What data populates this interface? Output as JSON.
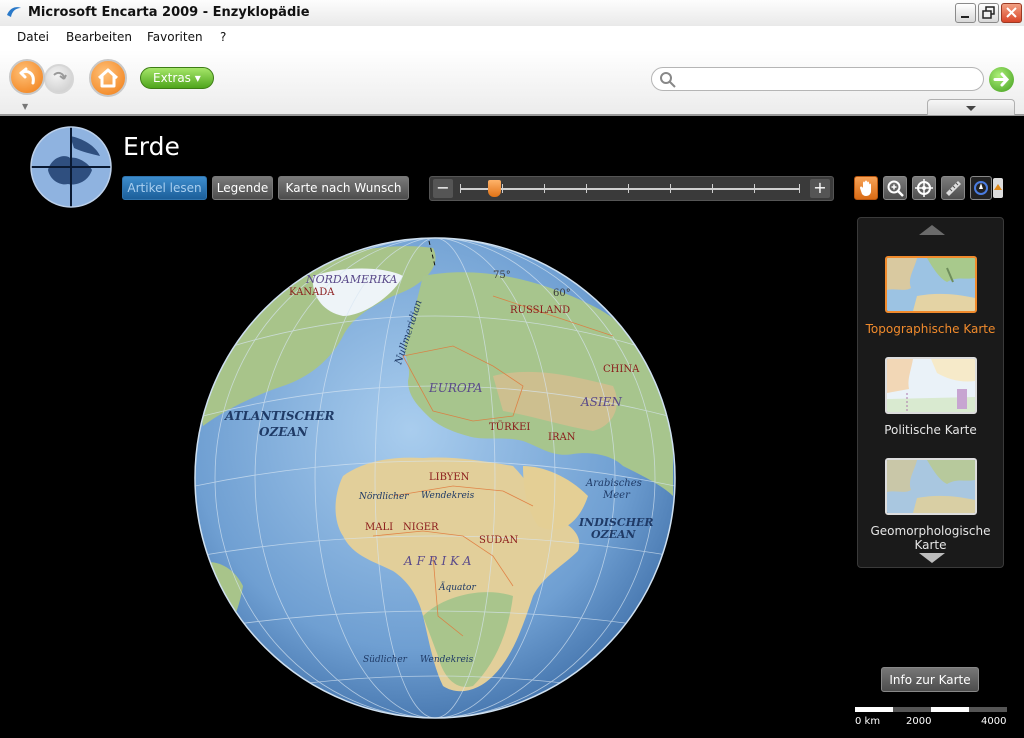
{
  "window": {
    "title": "Microsoft Encarta 2009 - Enzyklopädie"
  },
  "menu": {
    "items": [
      "Datei",
      "Bearbeiten",
      "Favoriten",
      "?"
    ]
  },
  "toolbar": {
    "extras_label": "Extras ▾",
    "search_placeholder": ""
  },
  "page": {
    "title": "Erde"
  },
  "buttons": {
    "article": "Artikel lesen",
    "legend": "Legende",
    "custom_map": "Karte nach Wunsch",
    "info": "Info zur Karte"
  },
  "zoom": {
    "minus": "−",
    "plus": "+",
    "level_fraction": 0.1
  },
  "map_types": [
    {
      "label": "Topographische Karte",
      "selected": true
    },
    {
      "label": "Politische Karte",
      "selected": false
    },
    {
      "label": "Geomorphologische Karte",
      "selected": false
    }
  ],
  "scale": {
    "labels": [
      "0 km",
      "2000",
      "4000"
    ]
  },
  "map_labels": {
    "nordamerika": "NORDAMERIKA",
    "kanada": "KANADA",
    "russland": "RUSSLAND",
    "europa": "EUROPA",
    "china": "CHINA",
    "asien": "ASIEN",
    "atlantik1": "ATLANTISCHER",
    "atlantik2": "OZEAN",
    "tuerkei": "TÜRKEI",
    "iran": "IRAN",
    "libyen": "LIBYEN",
    "noerdlicher": "Nördlicher",
    "wendekreis_n": "Wendekreis",
    "arabisches": "Arabisches",
    "meer": "Meer",
    "mali": "MALI",
    "niger": "NIGER",
    "sudan": "SUDAN",
    "indischer": "INDISCHER",
    "ozean": "OZEAN",
    "afrika": "A F R I K A",
    "aequator": "Äquator",
    "suedlicher": "Südlicher",
    "wendekreis_s": "Wendekreis",
    "nullmeridian": "Nullmeridian",
    "lat75": "75°",
    "lat60": "60°"
  },
  "icons": {
    "app": "encarta-icon",
    "back": "back-arrow-icon",
    "forward": "forward-arrow-icon",
    "home": "home-icon",
    "search": "search-icon",
    "go": "go-arrow-icon",
    "hand": "hand-icon",
    "zoom": "magnifier-icon",
    "locate": "crosshair-icon",
    "measure": "ruler-icon",
    "compass": "compass-icon"
  },
  "colors": {
    "accent": "#f08a2c",
    "active_button": "#2a72b0",
    "green": "#4fa51c"
  }
}
